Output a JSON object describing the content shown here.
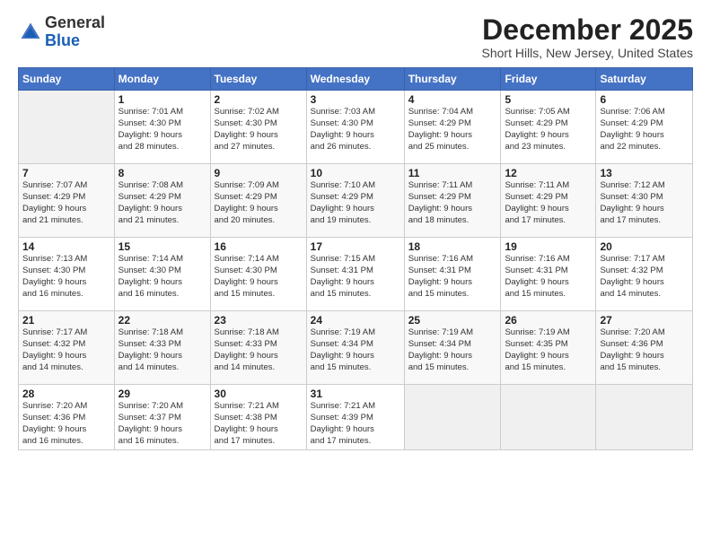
{
  "header": {
    "logo": {
      "line1": "General",
      "line2": "Blue"
    },
    "title": "December 2025",
    "location": "Short Hills, New Jersey, United States"
  },
  "weekdays": [
    "Sunday",
    "Monday",
    "Tuesday",
    "Wednesday",
    "Thursday",
    "Friday",
    "Saturday"
  ],
  "weeks": [
    [
      {
        "day": "",
        "info": ""
      },
      {
        "day": "1",
        "info": "Sunrise: 7:01 AM\nSunset: 4:30 PM\nDaylight: 9 hours\nand 28 minutes."
      },
      {
        "day": "2",
        "info": "Sunrise: 7:02 AM\nSunset: 4:30 PM\nDaylight: 9 hours\nand 27 minutes."
      },
      {
        "day": "3",
        "info": "Sunrise: 7:03 AM\nSunset: 4:30 PM\nDaylight: 9 hours\nand 26 minutes."
      },
      {
        "day": "4",
        "info": "Sunrise: 7:04 AM\nSunset: 4:29 PM\nDaylight: 9 hours\nand 25 minutes."
      },
      {
        "day": "5",
        "info": "Sunrise: 7:05 AM\nSunset: 4:29 PM\nDaylight: 9 hours\nand 23 minutes."
      },
      {
        "day": "6",
        "info": "Sunrise: 7:06 AM\nSunset: 4:29 PM\nDaylight: 9 hours\nand 22 minutes."
      }
    ],
    [
      {
        "day": "7",
        "info": "Sunrise: 7:07 AM\nSunset: 4:29 PM\nDaylight: 9 hours\nand 21 minutes."
      },
      {
        "day": "8",
        "info": "Sunrise: 7:08 AM\nSunset: 4:29 PM\nDaylight: 9 hours\nand 21 minutes."
      },
      {
        "day": "9",
        "info": "Sunrise: 7:09 AM\nSunset: 4:29 PM\nDaylight: 9 hours\nand 20 minutes."
      },
      {
        "day": "10",
        "info": "Sunrise: 7:10 AM\nSunset: 4:29 PM\nDaylight: 9 hours\nand 19 minutes."
      },
      {
        "day": "11",
        "info": "Sunrise: 7:11 AM\nSunset: 4:29 PM\nDaylight: 9 hours\nand 18 minutes."
      },
      {
        "day": "12",
        "info": "Sunrise: 7:11 AM\nSunset: 4:29 PM\nDaylight: 9 hours\nand 17 minutes."
      },
      {
        "day": "13",
        "info": "Sunrise: 7:12 AM\nSunset: 4:30 PM\nDaylight: 9 hours\nand 17 minutes."
      }
    ],
    [
      {
        "day": "14",
        "info": "Sunrise: 7:13 AM\nSunset: 4:30 PM\nDaylight: 9 hours\nand 16 minutes."
      },
      {
        "day": "15",
        "info": "Sunrise: 7:14 AM\nSunset: 4:30 PM\nDaylight: 9 hours\nand 16 minutes."
      },
      {
        "day": "16",
        "info": "Sunrise: 7:14 AM\nSunset: 4:30 PM\nDaylight: 9 hours\nand 15 minutes."
      },
      {
        "day": "17",
        "info": "Sunrise: 7:15 AM\nSunset: 4:31 PM\nDaylight: 9 hours\nand 15 minutes."
      },
      {
        "day": "18",
        "info": "Sunrise: 7:16 AM\nSunset: 4:31 PM\nDaylight: 9 hours\nand 15 minutes."
      },
      {
        "day": "19",
        "info": "Sunrise: 7:16 AM\nSunset: 4:31 PM\nDaylight: 9 hours\nand 15 minutes."
      },
      {
        "day": "20",
        "info": "Sunrise: 7:17 AM\nSunset: 4:32 PM\nDaylight: 9 hours\nand 14 minutes."
      }
    ],
    [
      {
        "day": "21",
        "info": "Sunrise: 7:17 AM\nSunset: 4:32 PM\nDaylight: 9 hours\nand 14 minutes."
      },
      {
        "day": "22",
        "info": "Sunrise: 7:18 AM\nSunset: 4:33 PM\nDaylight: 9 hours\nand 14 minutes."
      },
      {
        "day": "23",
        "info": "Sunrise: 7:18 AM\nSunset: 4:33 PM\nDaylight: 9 hours\nand 14 minutes."
      },
      {
        "day": "24",
        "info": "Sunrise: 7:19 AM\nSunset: 4:34 PM\nDaylight: 9 hours\nand 15 minutes."
      },
      {
        "day": "25",
        "info": "Sunrise: 7:19 AM\nSunset: 4:34 PM\nDaylight: 9 hours\nand 15 minutes."
      },
      {
        "day": "26",
        "info": "Sunrise: 7:19 AM\nSunset: 4:35 PM\nDaylight: 9 hours\nand 15 minutes."
      },
      {
        "day": "27",
        "info": "Sunrise: 7:20 AM\nSunset: 4:36 PM\nDaylight: 9 hours\nand 15 minutes."
      }
    ],
    [
      {
        "day": "28",
        "info": "Sunrise: 7:20 AM\nSunset: 4:36 PM\nDaylight: 9 hours\nand 16 minutes."
      },
      {
        "day": "29",
        "info": "Sunrise: 7:20 AM\nSunset: 4:37 PM\nDaylight: 9 hours\nand 16 minutes."
      },
      {
        "day": "30",
        "info": "Sunrise: 7:21 AM\nSunset: 4:38 PM\nDaylight: 9 hours\nand 17 minutes."
      },
      {
        "day": "31",
        "info": "Sunrise: 7:21 AM\nSunset: 4:39 PM\nDaylight: 9 hours\nand 17 minutes."
      },
      {
        "day": "",
        "info": ""
      },
      {
        "day": "",
        "info": ""
      },
      {
        "day": "",
        "info": ""
      }
    ]
  ]
}
